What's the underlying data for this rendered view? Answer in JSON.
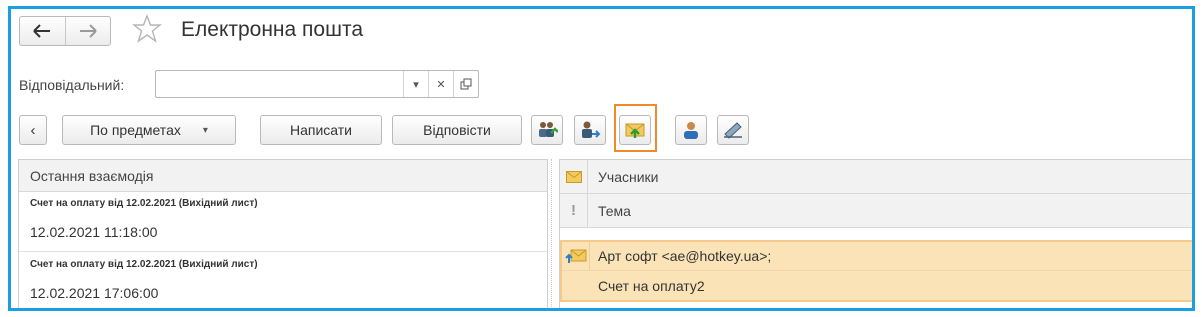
{
  "window": {
    "title": "Електронна пошта"
  },
  "filter": {
    "label": "Відповідальний:",
    "value": ""
  },
  "toolbar": {
    "group_by_label": "По предметах",
    "write_label": "Написати",
    "reply_label": "Відповісти"
  },
  "left_panel": {
    "header": "Остання взаємодія",
    "rows": [
      {
        "subject": "Счет на оплату від 12.02.2021 (Вихідний лист)",
        "date": "12.02.2021 11:18:00"
      },
      {
        "subject": "Счет на оплату від 12.02.2021 (Вихідний лист)",
        "date": "12.02.2021 17:06:00"
      }
    ]
  },
  "right_panel": {
    "header_participants": "Учасники",
    "header_subject": "Тема",
    "selected_message": {
      "participants": "Арт софт <ae@hotkey.ua>;",
      "subject": "Счет на оплату2"
    }
  },
  "icons": {
    "back": "back-arrow-icon",
    "forward": "forward-arrow-icon",
    "favorite": "star-icon",
    "envelope": "envelope-icon",
    "importance": "exclamation-icon"
  },
  "colors": {
    "frame": "#1a9fe0",
    "highlight": "#f08a2b",
    "selection_bg": "#fbe3b8",
    "selection_border": "#f5c98a"
  }
}
